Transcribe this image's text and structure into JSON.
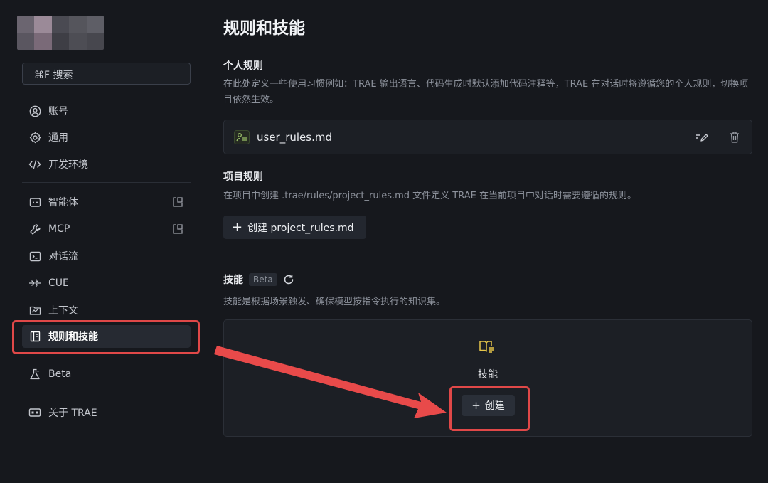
{
  "sidebar": {
    "search_label": "⌘F 搜索",
    "items": [
      {
        "label": "账号",
        "icon": "user-circle-icon"
      },
      {
        "label": "通用",
        "icon": "gear-icon"
      },
      {
        "label": "开发环境",
        "icon": "code-icon"
      },
      {
        "label": "智能体",
        "icon": "agent-icon"
      },
      {
        "label": "MCP",
        "icon": "wrench-icon"
      },
      {
        "label": "对话流",
        "icon": "terminal-icon"
      },
      {
        "label": "CUE",
        "icon": "cue-icon"
      },
      {
        "label": "上下文",
        "icon": "context-icon"
      },
      {
        "label": "规则和技能",
        "icon": "rules-book-icon",
        "active": true
      },
      {
        "label": "Beta",
        "icon": "flask-icon"
      },
      {
        "label": "关于 TRAE",
        "icon": "info-card-icon"
      }
    ]
  },
  "main": {
    "title": "规则和技能",
    "personal_rules": {
      "title": "个人规则",
      "description": "在此处定义一些使用习惯例如：TRAE 输出语言、代码生成时默认添加代码注释等，TRAE 在对话时将遵循您的个人规则，切换项目依然生效。",
      "file_name": "user_rules.md"
    },
    "project_rules": {
      "title": "项目规则",
      "description": "在项目中创建 .trae/rules/project_rules.md 文件定义 TRAE 在当前项目中对话时需要遵循的规则。",
      "create_label": "创建 project_rules.md"
    },
    "skills": {
      "title": "技能",
      "badge": "Beta",
      "description": "技能是根据场景触发、确保模型按指令执行的知识集。",
      "empty_label": "技能",
      "create_label": "创建"
    }
  },
  "colors": {
    "background": "#16181d",
    "panel": "#1c1f25",
    "highlight": "#e04848",
    "accent_yellow": "#e6c64a",
    "accent_green": "#9cc36a"
  }
}
